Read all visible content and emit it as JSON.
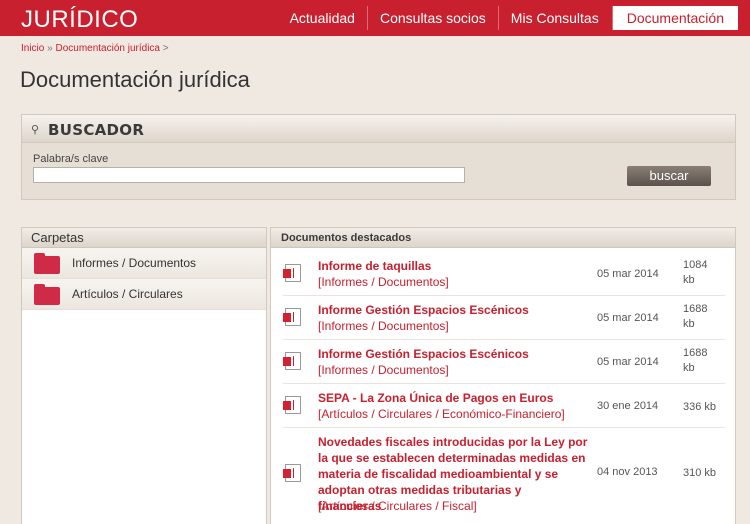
{
  "header": {
    "brand": "JURÍDICO",
    "nav": [
      "Actualidad",
      "Consultas socios",
      "Mis Consultas",
      "Documentación"
    ]
  },
  "breadcrumb": {
    "home": "Inicio",
    "sep": "»",
    "current": "Documentación jurídica",
    "trail": ">"
  },
  "page_title": "Documentación jurídica",
  "search": {
    "title": "BUSCADOR",
    "icon": "key-icon",
    "label": "Palabra/s clave",
    "value": "",
    "placeholder": "",
    "button": "buscar"
  },
  "folders": {
    "title": "Carpetas",
    "items": [
      "Informes / Documentos",
      "Artículos / Circulares"
    ]
  },
  "documents": {
    "title": "Documentos destacados",
    "items": [
      {
        "title": "Informe de taquillas",
        "category": "[Informes / Documentos]",
        "date": "05 mar 2014",
        "size": "1084 kb"
      },
      {
        "title": "Informe Gestión Espacios Escénicos",
        "category": "[Informes / Documentos]",
        "date": "05 mar 2014",
        "size": "1688 kb"
      },
      {
        "title": "Informe Gestión Espacios Escénicos",
        "category": "[Informes / Documentos]",
        "date": "05 mar 2014",
        "size": "1688 kb"
      },
      {
        "title": "SEPA - La Zona Única de Pagos en Euros",
        "category": "[Artículos / Circulares / Económico-Financiero]",
        "date": "30 ene 2014",
        "size": "336 kb"
      },
      {
        "title": "Novedades fiscales introducidas por la Ley por la que se establecen determinadas medidas en materia de fiscalidad medioambiental y se adoptan otras medidas tributarias y financieras",
        "category": "[Artículos / Circulares / Fiscal]",
        "date": "04 nov 2013",
        "size": "310 kb"
      }
    ]
  },
  "colors": {
    "brand_red": "#c8202e",
    "background": "#efe9e2",
    "folder_pink": "#d02a49"
  }
}
